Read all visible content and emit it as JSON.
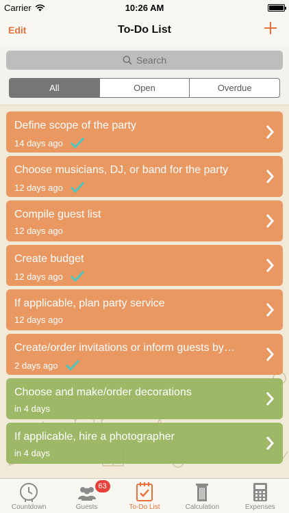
{
  "status_bar": {
    "carrier": "Carrier",
    "time": "10:26 AM",
    "battery_percent": 100
  },
  "nav": {
    "edit_label": "Edit",
    "title": "To-Do List",
    "add_icon": "plus-icon"
  },
  "search": {
    "placeholder": "Search"
  },
  "filter": {
    "segments": [
      "All",
      "Open",
      "Overdue"
    ],
    "selected": "All"
  },
  "colors": {
    "accent": "#e8703a",
    "orange_card": "#e8945c",
    "green_card": "#96b45e",
    "check": "#4bc6c2",
    "badge": "#e8413a"
  },
  "todos": [
    {
      "title": "Define scope of the party",
      "subtitle": "14 days ago",
      "done": true,
      "color": "orange"
    },
    {
      "title": "Choose musicians, DJ, or band for the party",
      "subtitle": "12 days ago",
      "done": true,
      "color": "orange"
    },
    {
      "title": "Compile guest list",
      "subtitle": "12 days ago",
      "done": false,
      "color": "orange"
    },
    {
      "title": "Create budget",
      "subtitle": "12 days ago",
      "done": true,
      "color": "orange"
    },
    {
      "title": "If applicable, plan party service",
      "subtitle": "12 days ago",
      "done": false,
      "color": "orange"
    },
    {
      "title": "Create/order invitations or inform guests by…",
      "subtitle": "2 days ago",
      "done": true,
      "color": "orange"
    },
    {
      "title": "Choose and make/order decorations",
      "subtitle": "in 4 days",
      "done": false,
      "color": "green"
    },
    {
      "title": "If applicable, hire a photographer",
      "subtitle": "in 4 days",
      "done": false,
      "color": "green"
    }
  ],
  "tabs": [
    {
      "label": "Countdown",
      "icon": "clock-icon",
      "active": false
    },
    {
      "label": "Guests",
      "icon": "people-icon",
      "active": false,
      "badge": "63"
    },
    {
      "label": "To-Do List",
      "icon": "checklist-icon",
      "active": true
    },
    {
      "label": "Calculation",
      "icon": "trash-can-icon",
      "active": false
    },
    {
      "label": "Expenses",
      "icon": "calculator-icon",
      "active": false
    }
  ]
}
